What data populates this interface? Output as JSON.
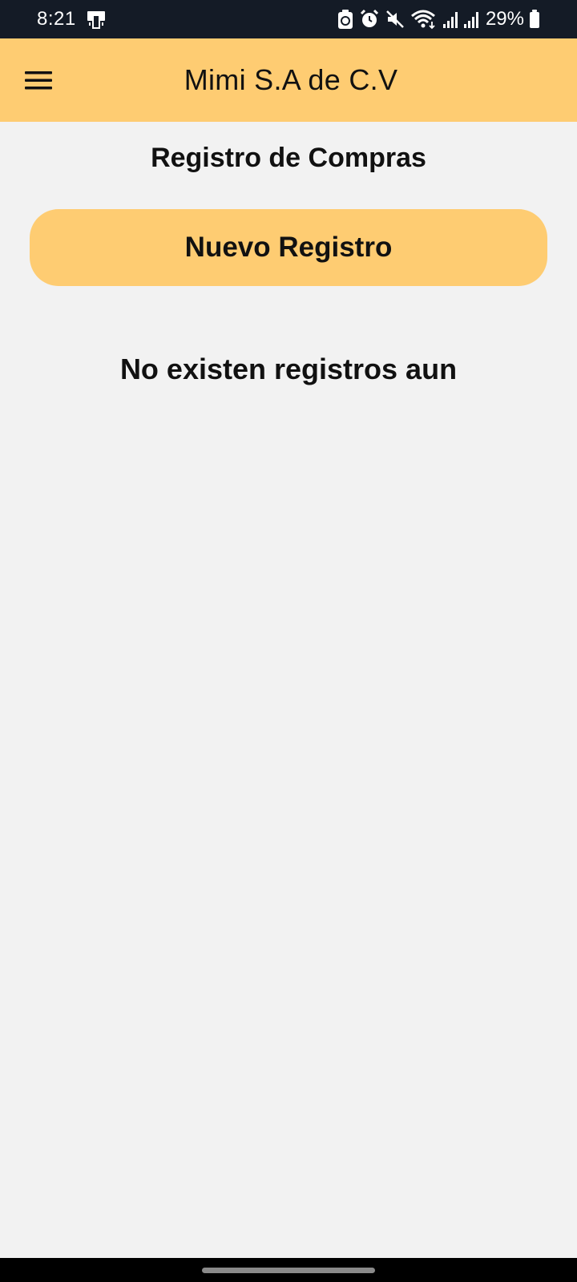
{
  "status_bar": {
    "time": "8:21",
    "battery_percent": "29%",
    "icons": [
      "notification-icon",
      "battery-saver-icon",
      "alarm-icon",
      "mute-icon",
      "wifi-icon",
      "signal-icon",
      "signal-icon",
      "battery-icon"
    ]
  },
  "app_bar": {
    "title": "Mimi S.A de C.V",
    "menu_icon": "menu-icon"
  },
  "main": {
    "heading": "Registro de Compras",
    "new_record_label": "Nuevo Registro",
    "empty_message": "No existen registros aun"
  },
  "colors": {
    "accent": "#fecc72",
    "background": "#f2f2f2",
    "status_bar": "#141b26"
  }
}
